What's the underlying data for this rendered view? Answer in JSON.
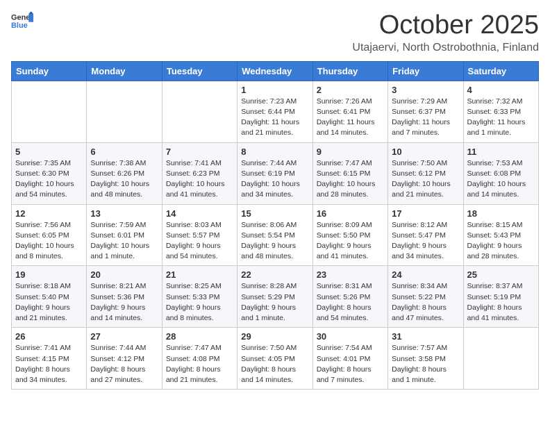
{
  "header": {
    "logo_general": "General",
    "logo_blue": "Blue",
    "month": "October 2025",
    "location": "Utajaervi, North Ostrobothnia, Finland"
  },
  "weekdays": [
    "Sunday",
    "Monday",
    "Tuesday",
    "Wednesday",
    "Thursday",
    "Friday",
    "Saturday"
  ],
  "weeks": [
    [
      {
        "day": "",
        "info": ""
      },
      {
        "day": "",
        "info": ""
      },
      {
        "day": "",
        "info": ""
      },
      {
        "day": "1",
        "info": "Sunrise: 7:23 AM\nSunset: 6:44 PM\nDaylight: 11 hours\nand 21 minutes."
      },
      {
        "day": "2",
        "info": "Sunrise: 7:26 AM\nSunset: 6:41 PM\nDaylight: 11 hours\nand 14 minutes."
      },
      {
        "day": "3",
        "info": "Sunrise: 7:29 AM\nSunset: 6:37 PM\nDaylight: 11 hours\nand 7 minutes."
      },
      {
        "day": "4",
        "info": "Sunrise: 7:32 AM\nSunset: 6:33 PM\nDaylight: 11 hours\nand 1 minute."
      }
    ],
    [
      {
        "day": "5",
        "info": "Sunrise: 7:35 AM\nSunset: 6:30 PM\nDaylight: 10 hours\nand 54 minutes."
      },
      {
        "day": "6",
        "info": "Sunrise: 7:38 AM\nSunset: 6:26 PM\nDaylight: 10 hours\nand 48 minutes."
      },
      {
        "day": "7",
        "info": "Sunrise: 7:41 AM\nSunset: 6:23 PM\nDaylight: 10 hours\nand 41 minutes."
      },
      {
        "day": "8",
        "info": "Sunrise: 7:44 AM\nSunset: 6:19 PM\nDaylight: 10 hours\nand 34 minutes."
      },
      {
        "day": "9",
        "info": "Sunrise: 7:47 AM\nSunset: 6:15 PM\nDaylight: 10 hours\nand 28 minutes."
      },
      {
        "day": "10",
        "info": "Sunrise: 7:50 AM\nSunset: 6:12 PM\nDaylight: 10 hours\nand 21 minutes."
      },
      {
        "day": "11",
        "info": "Sunrise: 7:53 AM\nSunset: 6:08 PM\nDaylight: 10 hours\nand 14 minutes."
      }
    ],
    [
      {
        "day": "12",
        "info": "Sunrise: 7:56 AM\nSunset: 6:05 PM\nDaylight: 10 hours\nand 8 minutes."
      },
      {
        "day": "13",
        "info": "Sunrise: 7:59 AM\nSunset: 6:01 PM\nDaylight: 10 hours\nand 1 minute."
      },
      {
        "day": "14",
        "info": "Sunrise: 8:03 AM\nSunset: 5:57 PM\nDaylight: 9 hours\nand 54 minutes."
      },
      {
        "day": "15",
        "info": "Sunrise: 8:06 AM\nSunset: 5:54 PM\nDaylight: 9 hours\nand 48 minutes."
      },
      {
        "day": "16",
        "info": "Sunrise: 8:09 AM\nSunset: 5:50 PM\nDaylight: 9 hours\nand 41 minutes."
      },
      {
        "day": "17",
        "info": "Sunrise: 8:12 AM\nSunset: 5:47 PM\nDaylight: 9 hours\nand 34 minutes."
      },
      {
        "day": "18",
        "info": "Sunrise: 8:15 AM\nSunset: 5:43 PM\nDaylight: 9 hours\nand 28 minutes."
      }
    ],
    [
      {
        "day": "19",
        "info": "Sunrise: 8:18 AM\nSunset: 5:40 PM\nDaylight: 9 hours\nand 21 minutes."
      },
      {
        "day": "20",
        "info": "Sunrise: 8:21 AM\nSunset: 5:36 PM\nDaylight: 9 hours\nand 14 minutes."
      },
      {
        "day": "21",
        "info": "Sunrise: 8:25 AM\nSunset: 5:33 PM\nDaylight: 9 hours\nand 8 minutes."
      },
      {
        "day": "22",
        "info": "Sunrise: 8:28 AM\nSunset: 5:29 PM\nDaylight: 9 hours\nand 1 minute."
      },
      {
        "day": "23",
        "info": "Sunrise: 8:31 AM\nSunset: 5:26 PM\nDaylight: 8 hours\nand 54 minutes."
      },
      {
        "day": "24",
        "info": "Sunrise: 8:34 AM\nSunset: 5:22 PM\nDaylight: 8 hours\nand 47 minutes."
      },
      {
        "day": "25",
        "info": "Sunrise: 8:37 AM\nSunset: 5:19 PM\nDaylight: 8 hours\nand 41 minutes."
      }
    ],
    [
      {
        "day": "26",
        "info": "Sunrise: 7:41 AM\nSunset: 4:15 PM\nDaylight: 8 hours\nand 34 minutes."
      },
      {
        "day": "27",
        "info": "Sunrise: 7:44 AM\nSunset: 4:12 PM\nDaylight: 8 hours\nand 27 minutes."
      },
      {
        "day": "28",
        "info": "Sunrise: 7:47 AM\nSunset: 4:08 PM\nDaylight: 8 hours\nand 21 minutes."
      },
      {
        "day": "29",
        "info": "Sunrise: 7:50 AM\nSunset: 4:05 PM\nDaylight: 8 hours\nand 14 minutes."
      },
      {
        "day": "30",
        "info": "Sunrise: 7:54 AM\nSunset: 4:01 PM\nDaylight: 8 hours\nand 7 minutes."
      },
      {
        "day": "31",
        "info": "Sunrise: 7:57 AM\nSunset: 3:58 PM\nDaylight: 8 hours\nand 1 minute."
      },
      {
        "day": "",
        "info": ""
      }
    ]
  ]
}
